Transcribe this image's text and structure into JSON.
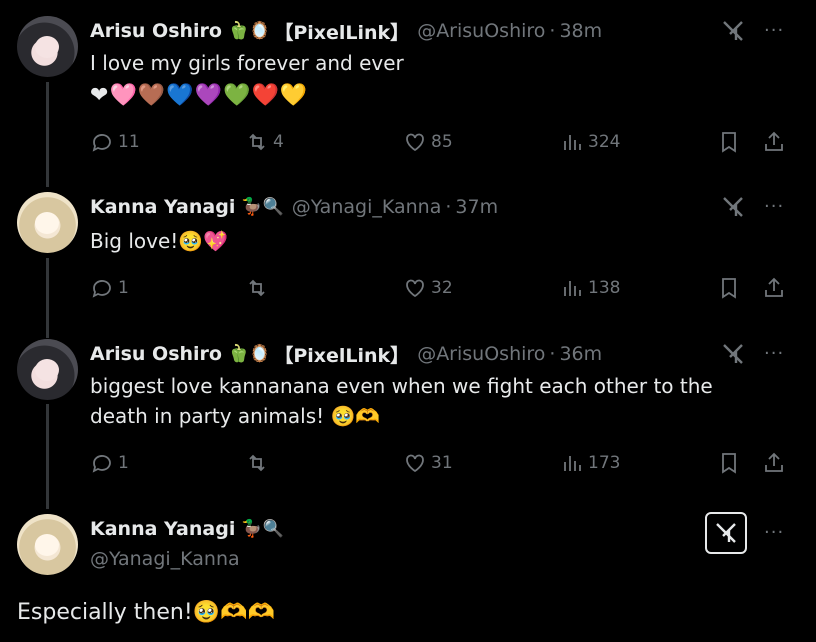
{
  "tweets": [
    {
      "name": "Arisu Oshiro",
      "badges": "🫑🪞",
      "tag": "【PixelLink】",
      "handle": "@ArisuOshiro",
      "time": "38m",
      "text": "I love my girls forever and ever",
      "hearts": [
        "❤",
        "🩷",
        "🤎",
        "💙",
        "💜",
        "💚",
        "❤️",
        "💛"
      ],
      "replies": "11",
      "reposts": "4",
      "likes": "85",
      "views": "324"
    },
    {
      "name": "Kanna Yanagi",
      "badges": "🦆🔍",
      "handle": "@Yanagi_Kanna",
      "time": "37m",
      "text": "Big love!🥹💖",
      "replies": "1",
      "reposts": "",
      "likes": "32",
      "views": "138"
    },
    {
      "name": "Arisu Oshiro",
      "badges": "🫑🪞",
      "tag": "【PixelLink】",
      "handle": "@ArisuOshiro",
      "time": "36m",
      "text_line1": "biggest love kannanana even when we fight each other to the",
      "text_line2": "death in party animals! 🥹🫶",
      "replies": "1",
      "reposts": "",
      "likes": "31",
      "views": "173"
    },
    {
      "name": "Kanna Yanagi",
      "badges": "🦆🔍",
      "handle": "@Yanagi_Kanna",
      "text": "Especially then!🥹🫶🫶"
    }
  ],
  "dot": "·",
  "more": "···",
  "icons": {
    "reply": "reply-icon",
    "repost": "repost-icon",
    "like": "heart-icon",
    "views": "views-icon",
    "bookmark": "bookmark-icon",
    "share": "share-icon",
    "grok": "grok-icon"
  }
}
